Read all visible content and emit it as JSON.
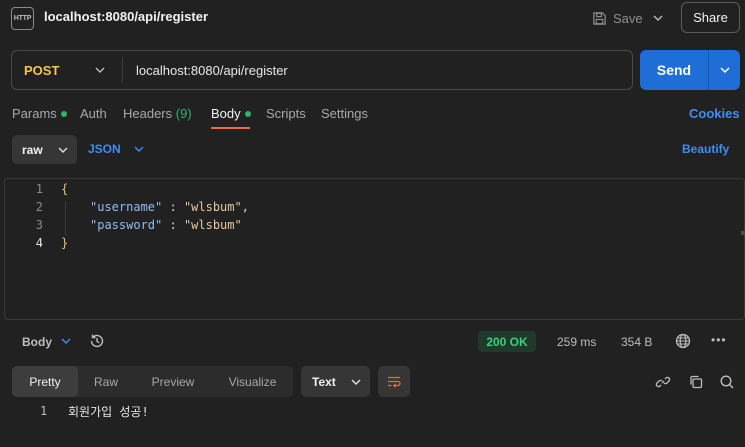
{
  "header": {
    "http_icon_text": "HTTP",
    "title": "localhost:8080/api/register",
    "save_label": "Save",
    "share_label": "Share"
  },
  "request": {
    "method": "POST",
    "url": "localhost:8080/api/register",
    "send_label": "Send"
  },
  "tabs": [
    {
      "label": "Params",
      "dot": true
    },
    {
      "label": "Auth"
    },
    {
      "label": "Headers",
      "count": "(9)"
    },
    {
      "label": "Body",
      "dot": true,
      "active": true
    },
    {
      "label": "Scripts"
    },
    {
      "label": "Settings"
    }
  ],
  "cookies_label": "Cookies",
  "body_mode": {
    "mode": "raw",
    "format": "JSON",
    "beautify_label": "Beautify"
  },
  "editor": {
    "line_numbers": [
      "1",
      "2",
      "3",
      "4"
    ],
    "lines": {
      "l1": "{",
      "l2_key": "\"username\"",
      "l2_sep": " : ",
      "l2_val": "\"wlsbum\"",
      "l2_end": ",",
      "l3_key": "\"password\"",
      "l3_sep": " : ",
      "l3_val": "\"wlsbum\"",
      "l4": "}"
    }
  },
  "response": {
    "body_label": "Body",
    "status": "200 OK",
    "time": "259 ms",
    "size": "354 B",
    "more": "•••",
    "view_tabs": [
      "Pretty",
      "Raw",
      "Preview",
      "Visualize"
    ],
    "format": "Text",
    "line_number": "1",
    "content": "회원가입 성공!"
  },
  "colors": {
    "accent_blue": "#1e6ed6",
    "link_blue": "#3e8ef7",
    "method_yellow": "#f7c548",
    "success_green": "#3ccf7f",
    "active_tab_underline": "#f06b3a"
  }
}
